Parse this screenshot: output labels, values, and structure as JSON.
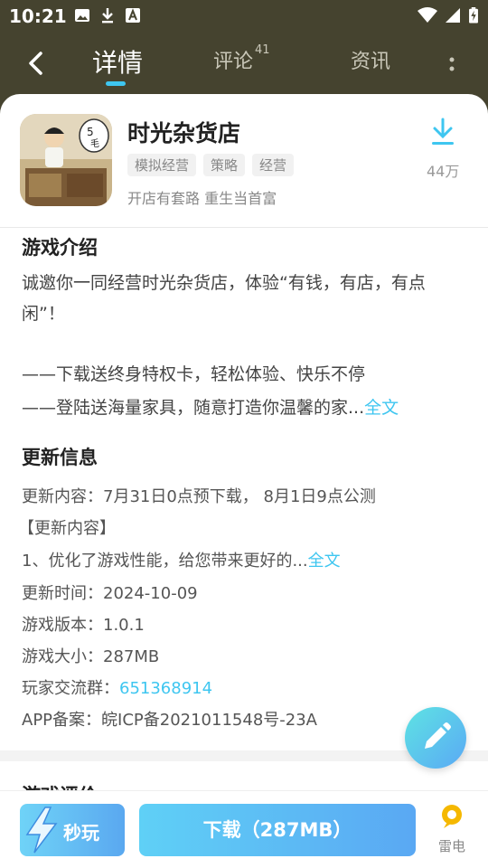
{
  "status_bar": {
    "time": "10:21"
  },
  "nav": {
    "tabs": [
      {
        "label": "详情"
      },
      {
        "label": "评论",
        "count": "41"
      },
      {
        "label": "资讯"
      }
    ]
  },
  "app": {
    "title": "时光杂货店",
    "tags": [
      "模拟经营",
      "策略",
      "经营"
    ],
    "slogan": "开店有套路 重生当首富",
    "downloads": "44万",
    "icon_text": "5毛"
  },
  "intro": {
    "title": "游戏介绍",
    "para1": "诚邀你一同经营时光杂货店，体验“有钱，有店，有点闲”！",
    "line1": "——下载送终身特权卡，轻松体验、快乐不停",
    "line2": "——登陆送海量家具，随意打造你温馨的家...",
    "more": "全文"
  },
  "update": {
    "title": "更新信息",
    "content_line": "更新内容：7月31日0点预下载， 8月1日9点公测",
    "bracket": "【更新内容】",
    "item1": "1、优化了游戏性能，给您带来更好的...",
    "more": "全文",
    "time_label": "更新时间：",
    "time_value": "2024-10-09",
    "version_label": "游戏版本：",
    "version_value": "1.0.1",
    "size_label": "游戏大小：",
    "size_value": "287MB",
    "group_label": "玩家交流群：",
    "group_value": "651368914",
    "icp": "APP备案：皖ICP备2021011548号-23A"
  },
  "next_section_title": "游戏评价",
  "bottom": {
    "quick_play": "秒玩",
    "download": "下载（287MB）",
    "leidian": "雷电"
  },
  "colors": {
    "header": "#45432f",
    "accent": "#3ec6f0"
  }
}
